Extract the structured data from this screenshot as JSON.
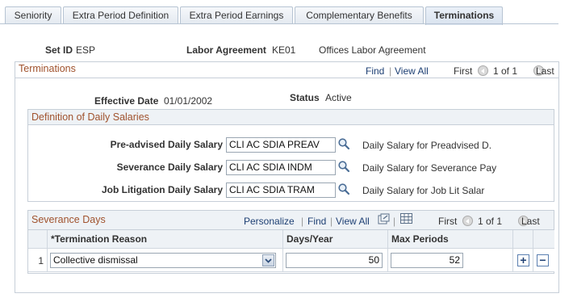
{
  "tabs": [
    {
      "label": "Seniority",
      "active": false
    },
    {
      "label": "Extra Period Definition",
      "active": false
    },
    {
      "label": "Extra Period Earnings",
      "active": false
    },
    {
      "label": "Complementary Benefits",
      "active": false
    },
    {
      "label": "Terminations",
      "active": true
    }
  ],
  "header": {
    "setid_label": "Set ID",
    "setid_value": "ESP",
    "labor_label": "Labor Agreement",
    "labor_value": "KE01",
    "labor_desc": "Offices Labor Agreement"
  },
  "terminations": {
    "title": "Terminations",
    "find": "Find",
    "view_all": "View All",
    "first": "First",
    "count": "1 of 1",
    "last": "Last",
    "effdt_label": "Effective Date",
    "effdt_value": "01/01/2002",
    "status_label": "Status",
    "status_value": "Active"
  },
  "daily": {
    "title": "Definition of Daily Salaries",
    "rows": [
      {
        "label": "Pre-advised Daily Salary",
        "value": "CLI AC SDIA PREAV",
        "desc": "Daily Salary for Preadvised D."
      },
      {
        "label": "Severance Daily Salary",
        "value": "CLI AC SDIA INDM",
        "desc": "Daily Salary for Severance Pay"
      },
      {
        "label": "Job Litigation Daily Salary",
        "value": "CLI AC SDIA TRAM",
        "desc": "Daily Salary for Job Lit Salar"
      }
    ]
  },
  "severance": {
    "title": "Severance Days",
    "personalize": "Personalize",
    "find": "Find",
    "view_all": "View All",
    "first": "First",
    "count": "1 of 1",
    "last": "Last",
    "columns": {
      "reason": "*Termination Reason",
      "days": "Days/Year",
      "max": "Max Periods"
    },
    "row": {
      "num": "1",
      "reason": "Collective dismissal",
      "days": "50",
      "max": "52"
    },
    "add": "+",
    "remove": "−"
  },
  "colors": {
    "accent": "#a0522d",
    "link": "#1d3f73",
    "border": "#c7cfd8"
  }
}
